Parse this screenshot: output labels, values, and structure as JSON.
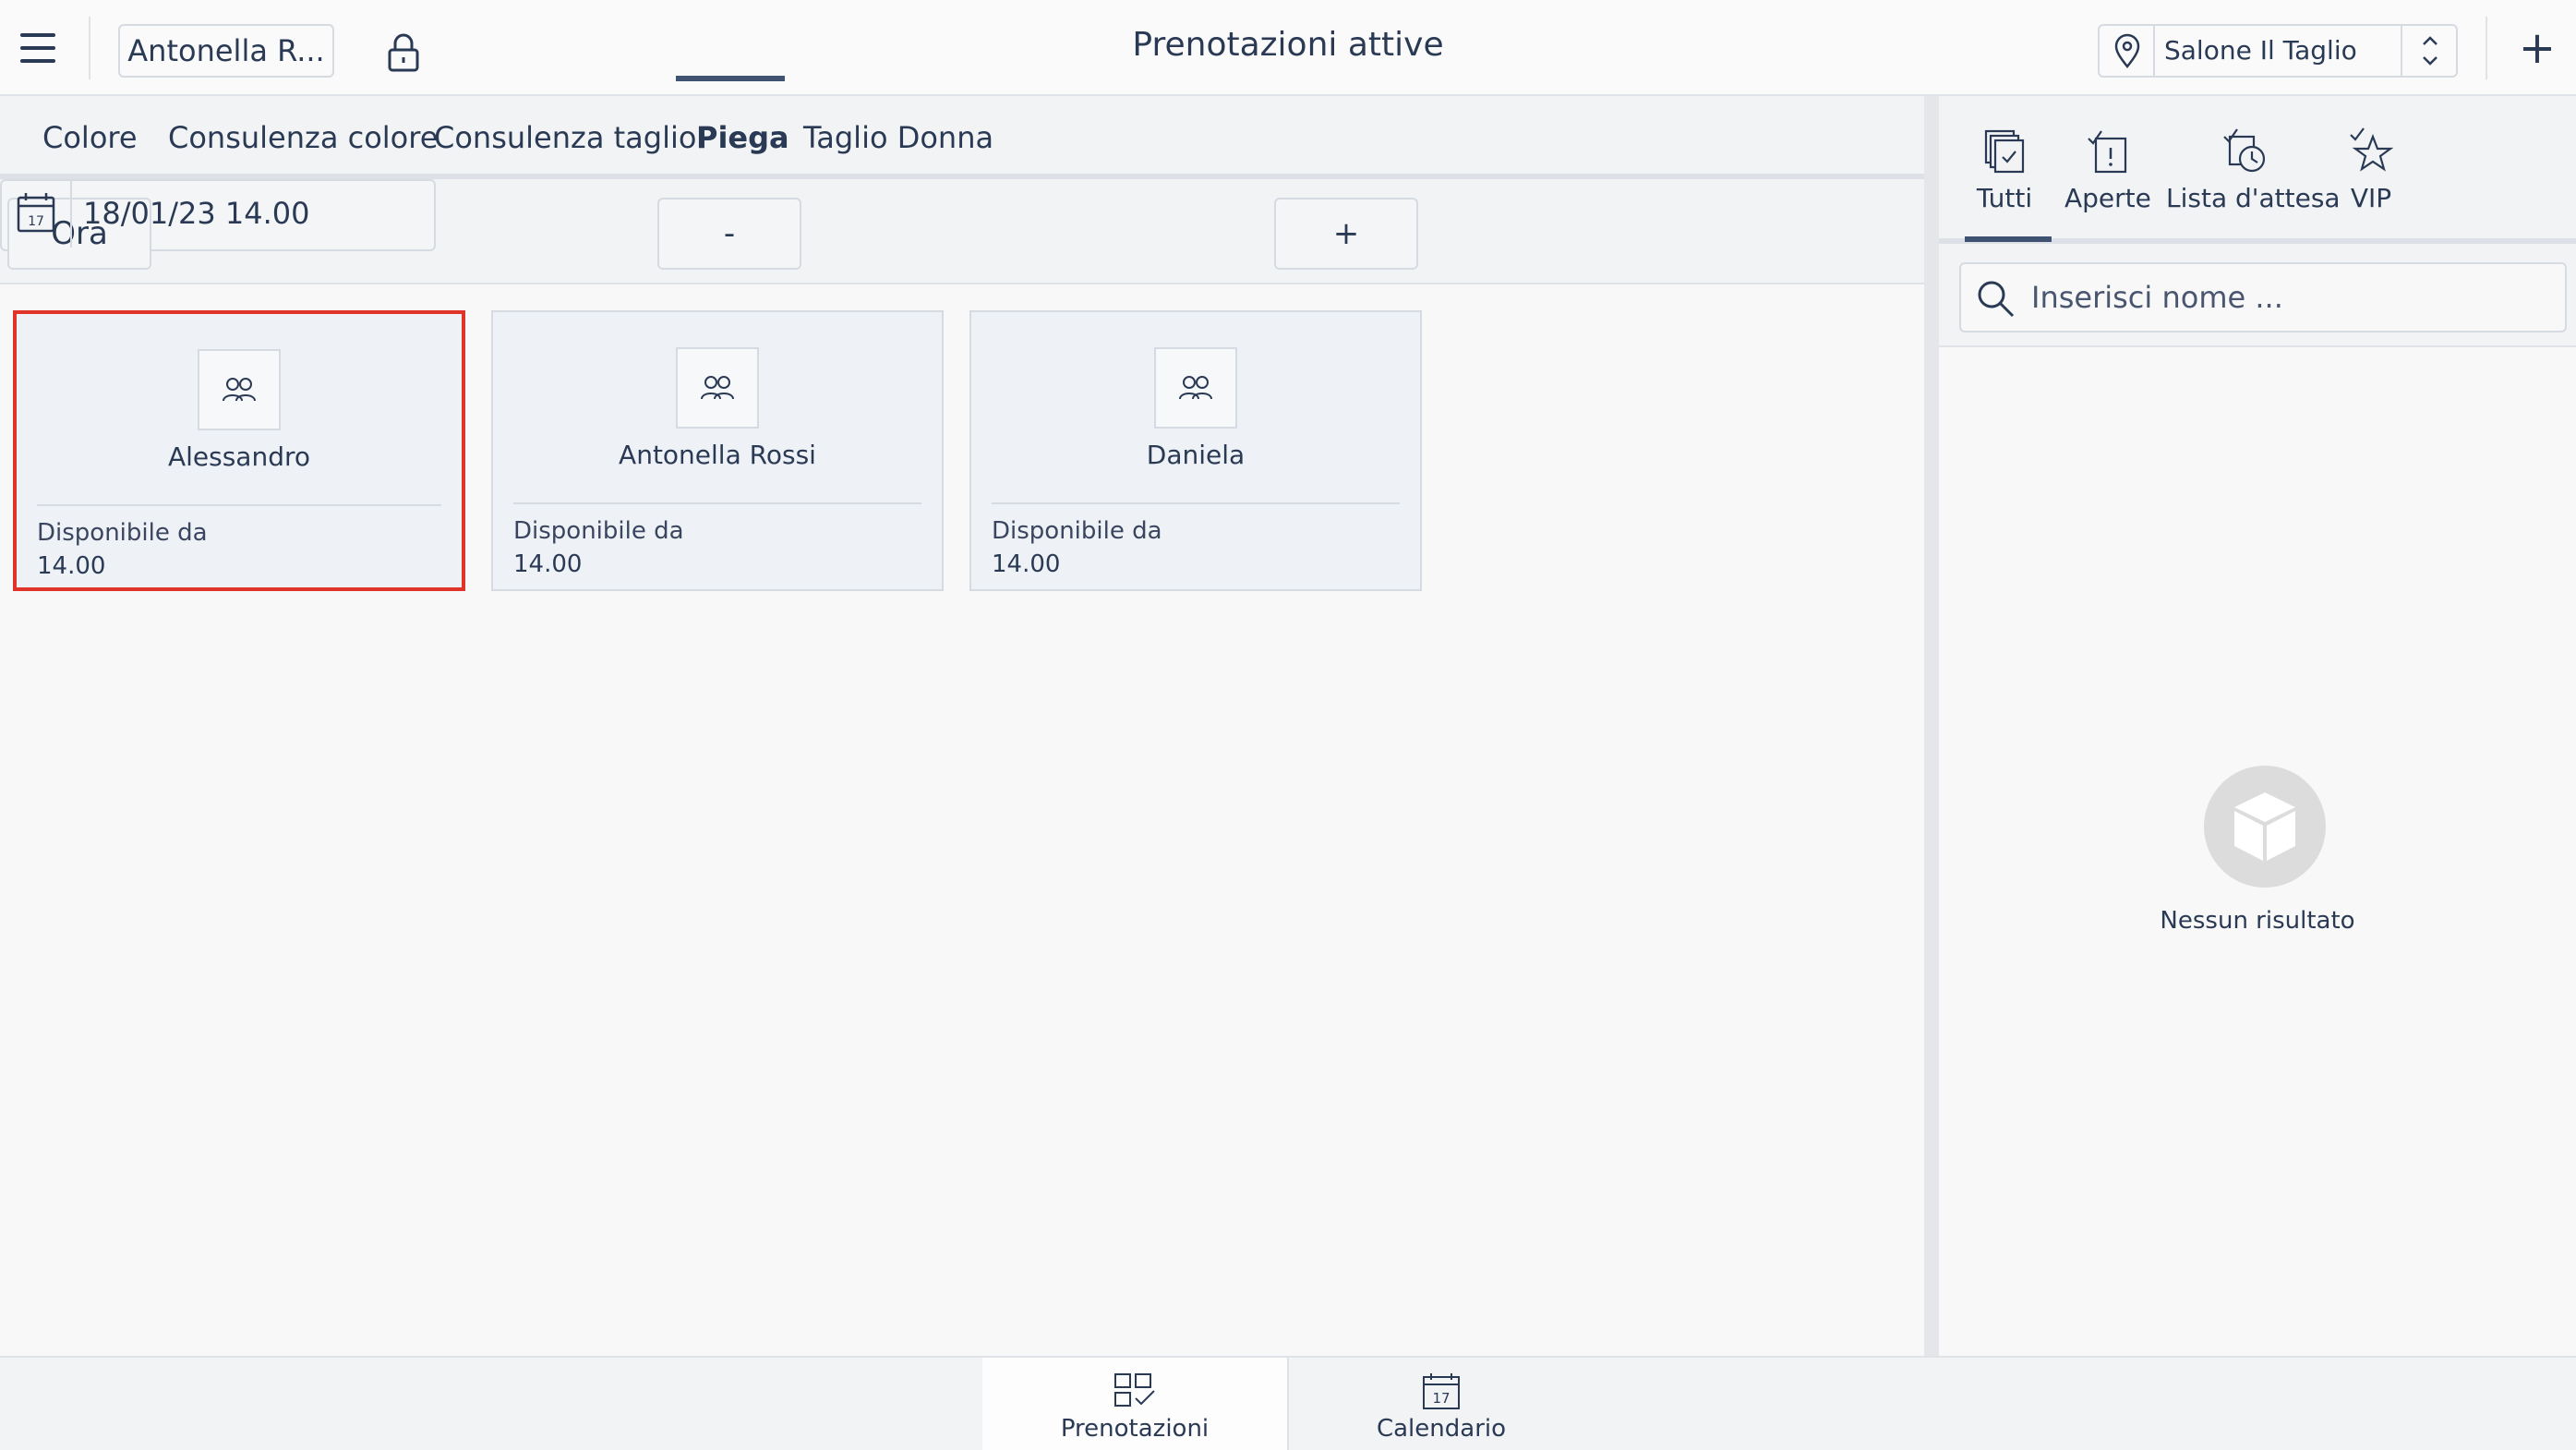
{
  "header": {
    "user_label": "Antonella R...",
    "title": "Prenotazioni attive",
    "salon_label": "Salone Il Taglio",
    "add_label": "+"
  },
  "tabs": [
    {
      "label": "Colore"
    },
    {
      "label": "Consulenza colore"
    },
    {
      "label": "Consulenza taglio"
    },
    {
      "label": "Piega",
      "active": true
    },
    {
      "label": "Taglio Donna"
    }
  ],
  "controls": {
    "now_label": "Ora",
    "minus_label": "-",
    "plus_label": "+",
    "date_value": "18/01/23 14.00",
    "calendar_day": "17"
  },
  "staff": [
    {
      "name": "Alessandro",
      "avail_label": "Disponibile da",
      "avail_time": "14.00",
      "selected": true
    },
    {
      "name": "Antonella Rossi",
      "avail_label": "Disponibile da",
      "avail_time": "14.00"
    },
    {
      "name": "Daniela",
      "avail_label": "Disponibile da",
      "avail_time": "14.00"
    }
  ],
  "right_panel": {
    "filters": [
      {
        "label": "Tutti",
        "icon": "all-bookings-icon",
        "active": true
      },
      {
        "label": "Aperte",
        "icon": "open-bookings-icon"
      },
      {
        "label": "Lista d'attesa",
        "icon": "waiting-list-icon"
      },
      {
        "label": "VIP",
        "icon": "vip-star-icon"
      }
    ],
    "search_placeholder": "Inserisci nome ...",
    "empty_text": "Nessun risultato"
  },
  "bottom_nav": [
    {
      "label": "Prenotazioni",
      "icon": "bookings-grid-icon",
      "active": true
    },
    {
      "label": "Calendario",
      "icon": "calendar-icon"
    }
  ],
  "colors": {
    "accent": "#3f5272",
    "selection": "#e0342a",
    "text": "#2a3a55"
  }
}
